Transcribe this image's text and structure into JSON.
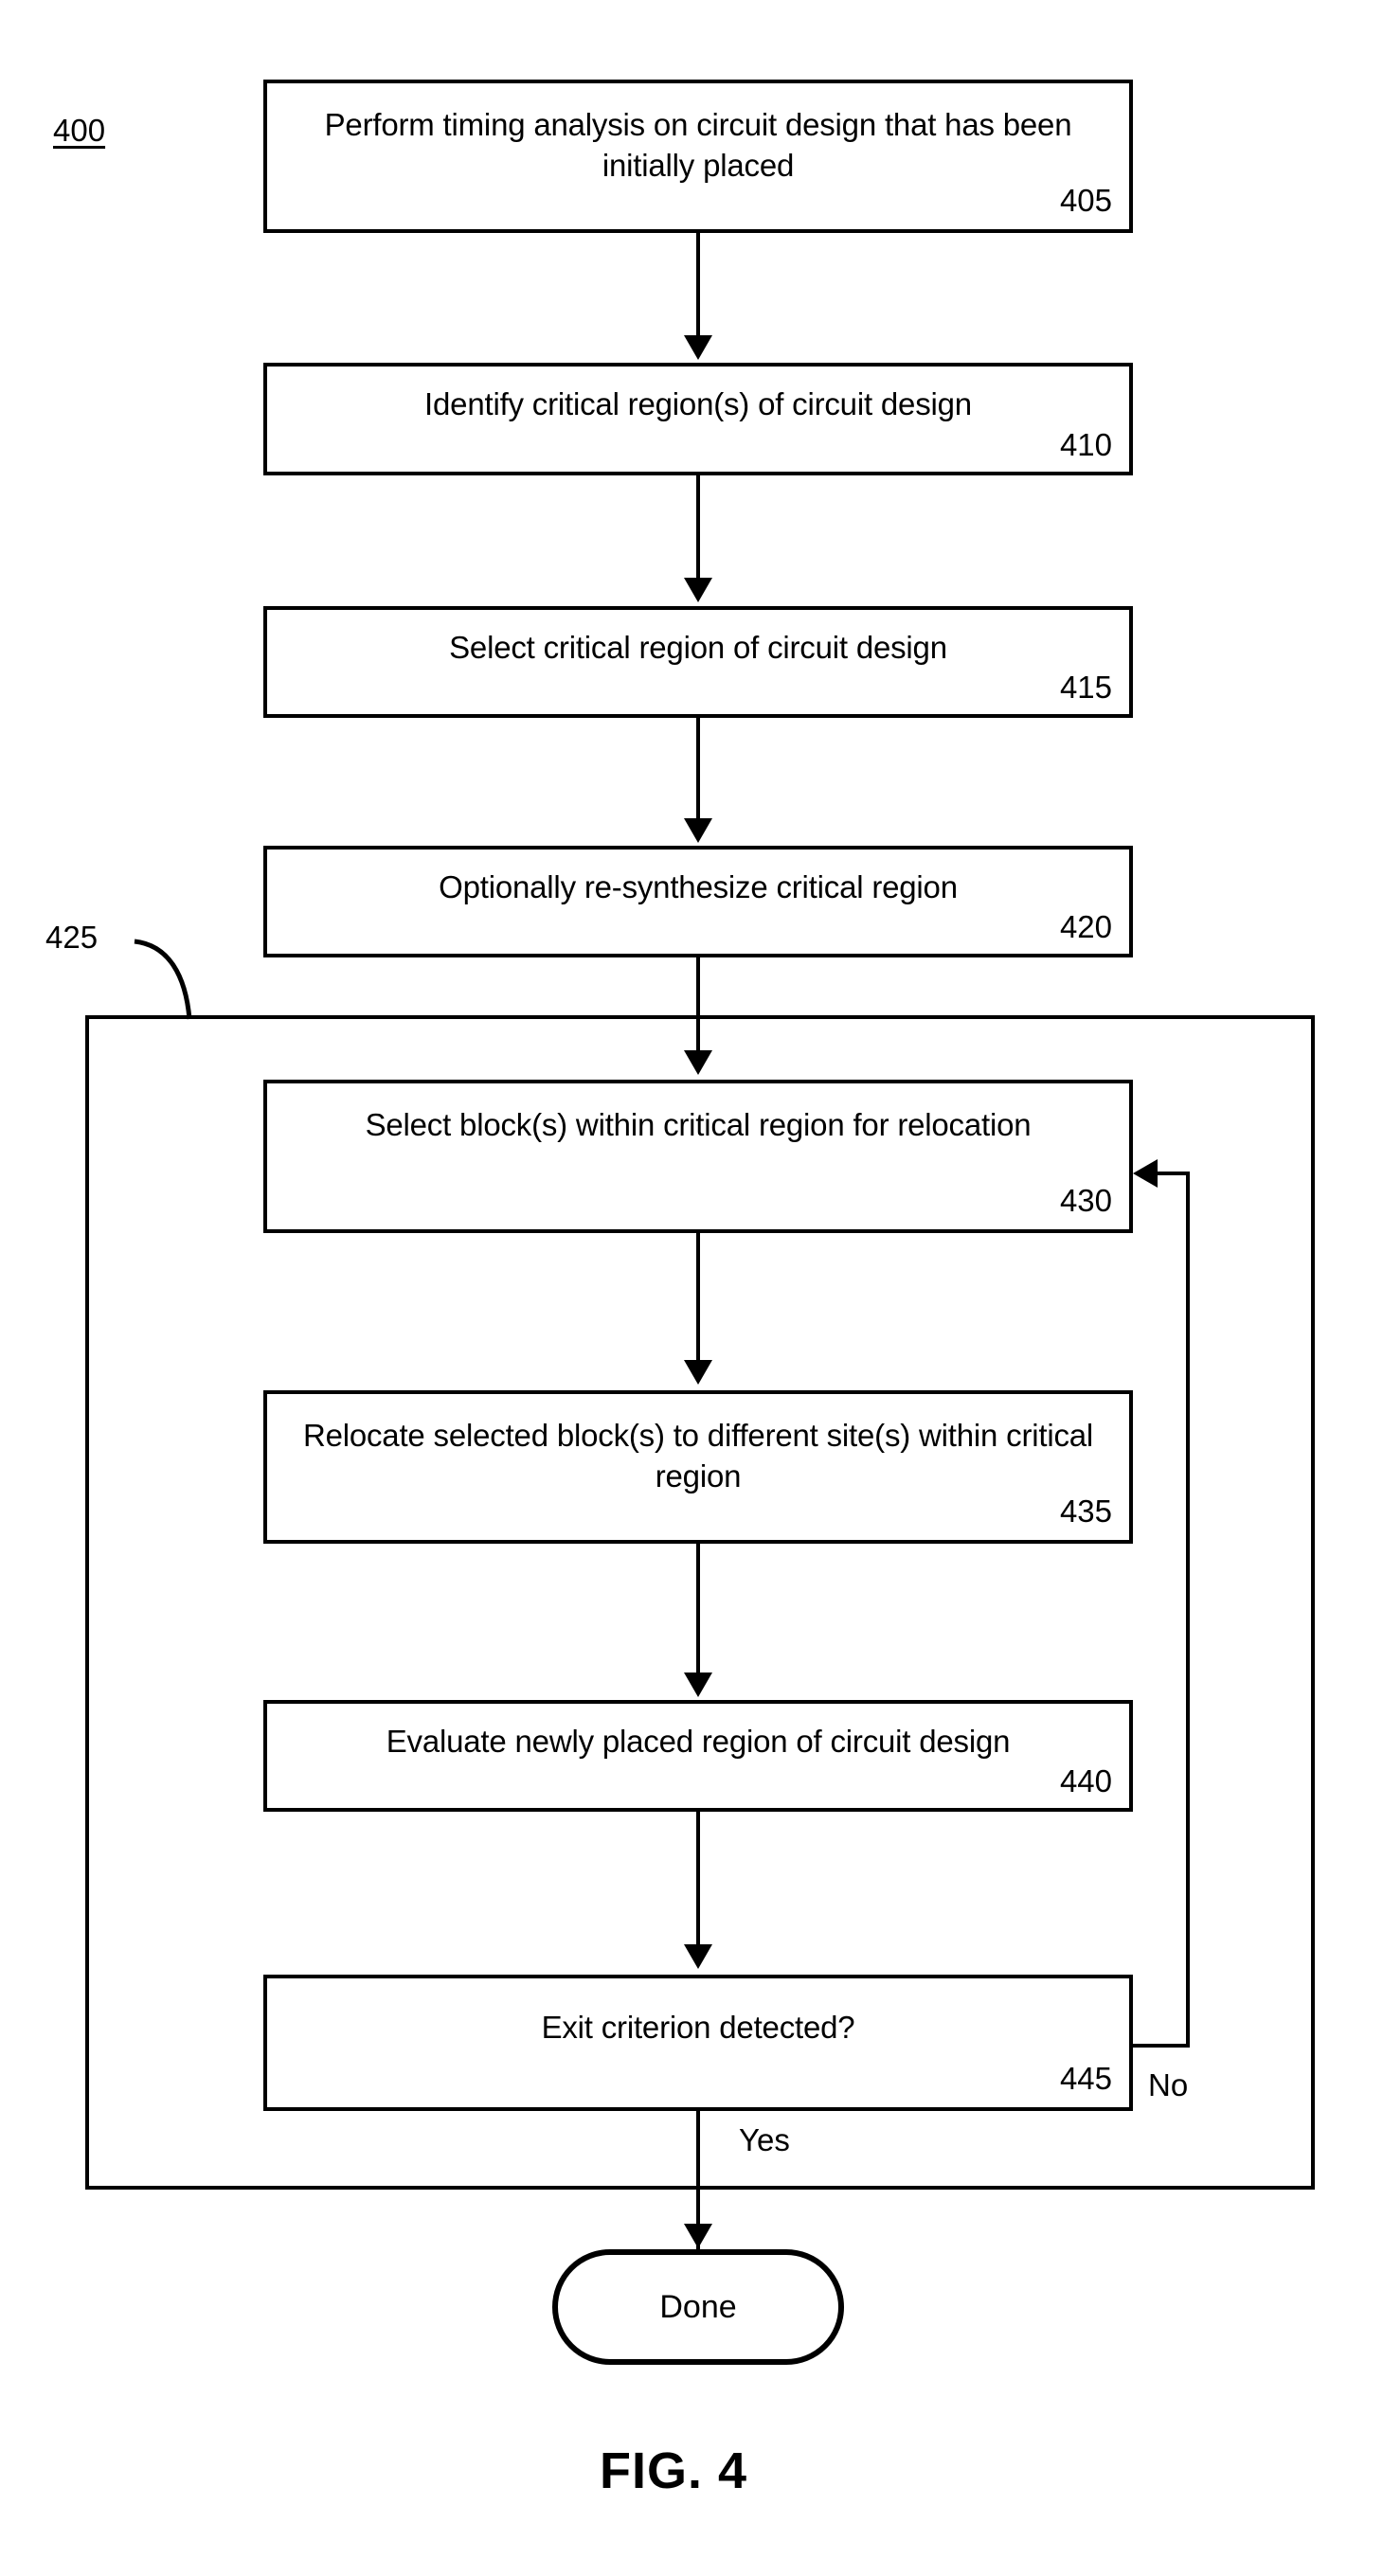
{
  "figure": {
    "number_label": "400",
    "caption": "FIG. 4"
  },
  "nodes": [
    {
      "id": "step-405",
      "text": "Perform timing analysis on circuit design that has been initially placed",
      "ref": "405"
    },
    {
      "id": "step-410",
      "text": "Identify critical region(s) of circuit design",
      "ref": "410"
    },
    {
      "id": "step-415",
      "text": "Select critical region of circuit design",
      "ref": "415"
    },
    {
      "id": "step-420",
      "text": "Optionally re-synthesize critical region",
      "ref": "420"
    },
    {
      "id": "step-430",
      "text": "Select block(s) within critical region for relocation",
      "ref": "430"
    },
    {
      "id": "step-435",
      "text": "Relocate selected block(s) to different site(s) within critical region",
      "ref": "435"
    },
    {
      "id": "step-440",
      "text": "Evaluate newly placed region of circuit design",
      "ref": "440"
    },
    {
      "id": "decision-445",
      "text": "Exit criterion detected?",
      "ref": "445"
    }
  ],
  "loop": {
    "ref": "425"
  },
  "terminator": {
    "label": "Done"
  },
  "branch_labels": {
    "no": "No",
    "yes": "Yes"
  },
  "colors": {
    "stroke": "#000000",
    "background": "#ffffff"
  }
}
